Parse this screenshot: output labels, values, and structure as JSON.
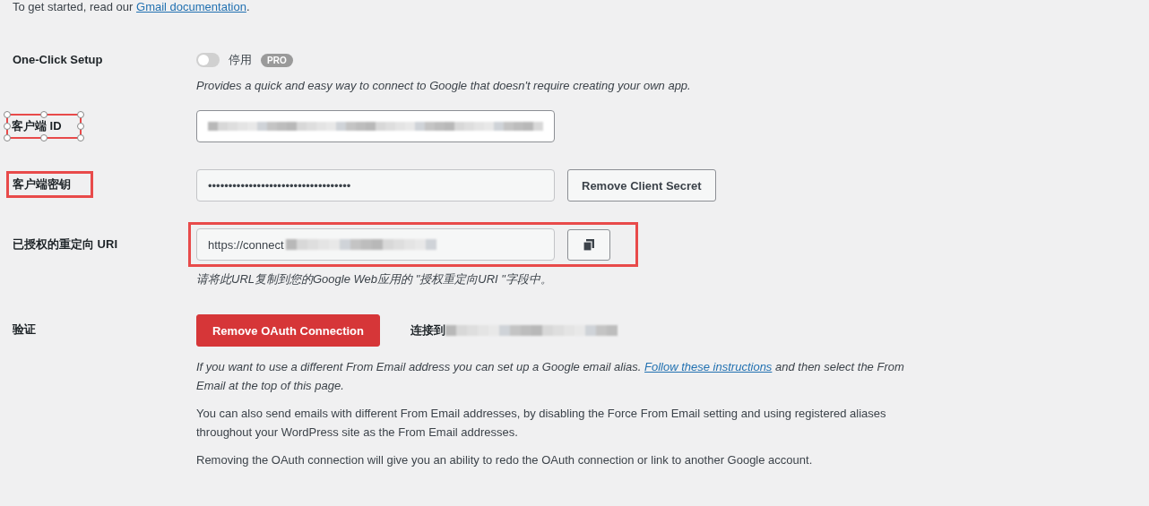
{
  "intro": {
    "text": "To get started, read our ",
    "link": "Gmail documentation",
    "after": "."
  },
  "rows": [
    {
      "kind": "toggle",
      "label": "One-Click Setup",
      "on": false,
      "state_text": "停用",
      "badge": "PRO",
      "description": "Provides a quick and easy way to connect to Google that doesn't require creating your own app."
    },
    {
      "kind": "field",
      "label": "客户端 ID",
      "annotated": true,
      "handles": true,
      "redacted": true
    },
    {
      "kind": "secret",
      "label": "客户端密钥",
      "annotated": true,
      "handles": false,
      "value": "•••••••••••••••••••••••••••••••••••",
      "button": "Remove Client Secret"
    },
    {
      "kind": "copy",
      "label": "已授权的重定向 URI",
      "annotated": true,
      "value": "https://connect",
      "redacted": true,
      "description": "请将此URL复制到您的Google Web应用的 \"授权重定向URI \"字段中。"
    },
    {
      "kind": "auth",
      "label": "验证",
      "button": "Remove OAuth Connection",
      "connected_text": "连接到",
      "redacted": true,
      "notes": [
        {
          "text": "If you want to use a different From Email address you can set up a Google email alias. ",
          "link": "Follow these instructions",
          "after": " and then select the From Email at the top of this page.",
          "italic": true
        },
        {
          "text": "You can also send emails with different From Email addresses, by disabling the Force From Email setting and using registered aliases throughout your WordPress site as the From Email addresses.",
          "italic": false
        },
        {
          "text": "Removing the OAuth connection will give you an ability to redo the OAuth connection or link to another Google account.",
          "italic": false
        }
      ]
    }
  ]
}
